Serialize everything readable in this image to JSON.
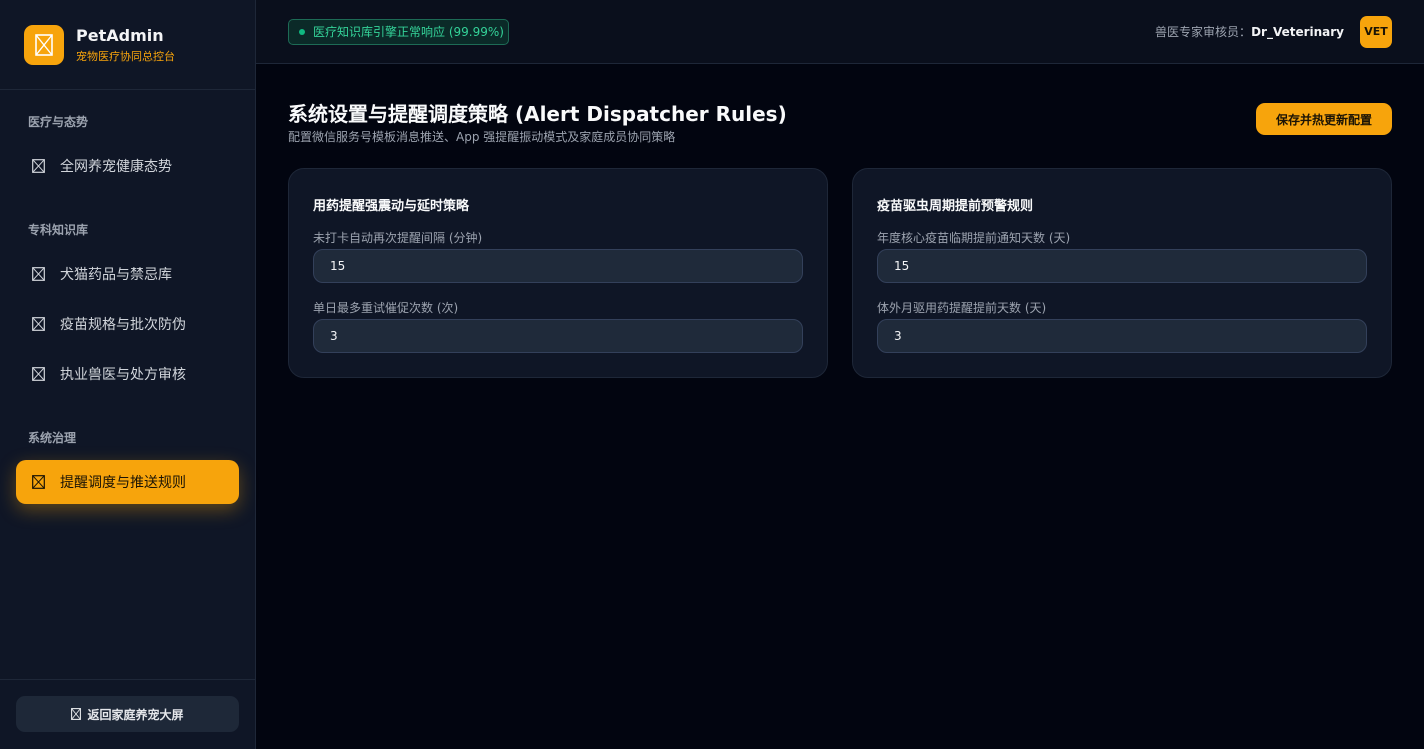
{
  "brand": {
    "title": "PetAdmin",
    "subtitle": "宠物医疗协同总控台"
  },
  "sidebar": {
    "groups": [
      {
        "label": "医疗与态势",
        "items": [
          {
            "label": "全网养宠健康态势",
            "icon": "box-icon"
          }
        ]
      },
      {
        "label": "专科知识库",
        "items": [
          {
            "label": "犬猫药品与禁忌库",
            "icon": "box-icon"
          },
          {
            "label": "疫苗规格与批次防伪",
            "icon": "box-icon"
          },
          {
            "label": "执业兽医与处方审核",
            "icon": "box-icon"
          }
        ]
      },
      {
        "label": "系统治理",
        "items": [
          {
            "label": "提醒调度与推送规则",
            "icon": "box-icon",
            "active": true
          }
        ]
      }
    ],
    "footer_button": "返回家庭养宠大屏"
  },
  "header": {
    "status": "医疗知识库引擎正常响应 (99.99%)",
    "reviewer_label": "兽医专家审核员：",
    "reviewer_name": "Dr_Veterinary",
    "avatar": "VET"
  },
  "main": {
    "title": "系统设置与提醒调度策略 (Alert Dispatcher Rules)",
    "subtitle": "配置微信服务号模板消息推送、App 强提醒振动模式及家庭成员协同策略",
    "save_label": "保存并热更新配置",
    "cards": [
      {
        "title": "用药提醒强震动与延时策略",
        "fields": [
          {
            "label": "未打卡自动再次提醒间隔 (分钟)",
            "value": "15"
          },
          {
            "label": "单日最多重试催促次数 (次)",
            "value": "3"
          }
        ]
      },
      {
        "title": "疫苗驱虫周期提前预警规则",
        "fields": [
          {
            "label": "年度核心疫苗临期提前通知天数 (天)",
            "value": "15"
          },
          {
            "label": "体外月驱用药提醒提前天数 (天)",
            "value": "3"
          }
        ]
      }
    ]
  },
  "colors": {
    "accent": "#f7a40c",
    "background": "#020510",
    "panel": "#0f1626",
    "status_green": "#34d399"
  }
}
